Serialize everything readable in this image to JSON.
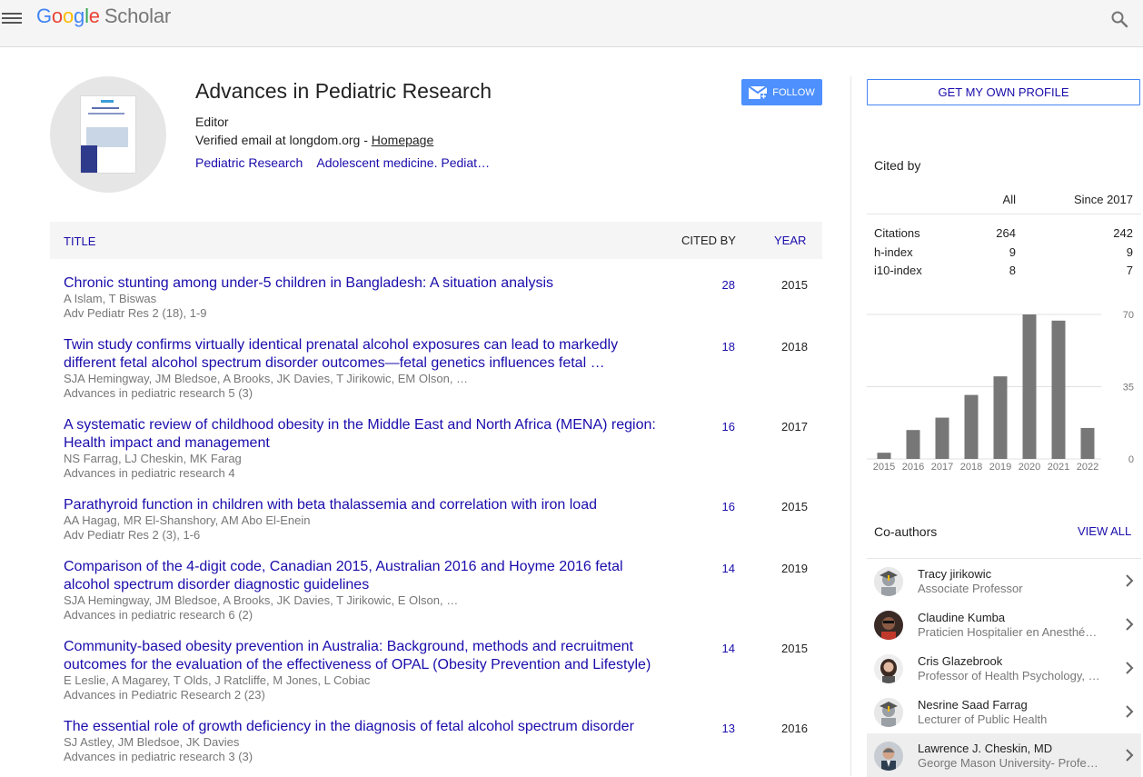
{
  "header": {
    "logo_google": [
      "G",
      "o",
      "o",
      "g",
      "l",
      "e"
    ],
    "logo_scholar": "Scholar",
    "menu_icon": "hamburger-menu-icon",
    "search_icon": "search-icon"
  },
  "profile": {
    "name": "Advances in Pediatric Research",
    "affiliation": "Editor",
    "email_text": "Verified email at longdom.org - ",
    "homepage_link": "Homepage",
    "interests": [
      "Pediatric Research",
      "Adolescent medicine. Pediat…"
    ],
    "follow_label": "FOLLOW",
    "follow_icon": "envelope-icon"
  },
  "table": {
    "headers": {
      "title": "TITLE",
      "cited_by": "CITED BY",
      "year": "YEAR"
    },
    "articles": [
      {
        "title": "Chronic stunting among under-5 children in Bangladesh: A situation analysis",
        "authors": "A Islam, T Biswas",
        "venue": "Adv Pediatr Res 2 (18), 1-9",
        "cited_by": "28",
        "year": "2015"
      },
      {
        "title": "Twin study confirms virtually identical prenatal alcohol exposures can lead to markedly different fetal alcohol spectrum disorder outcomes—fetal genetics influences fetal …",
        "authors": "SJA Hemingway, JM Bledsoe, A Brooks, JK Davies, T Jirikowic, EM Olson, …",
        "venue": "Advances in pediatric research 5 (3)",
        "cited_by": "18",
        "year": "2018"
      },
      {
        "title": "A systematic review of childhood obesity in the Middle East and North Africa (MENA) region: Health impact and management",
        "authors": "NS Farrag, LJ Cheskin, MK Farag",
        "venue": "Advances in pediatric research 4",
        "cited_by": "16",
        "year": "2017"
      },
      {
        "title": "Parathyroid function in children with beta thalassemia and correlation with iron load",
        "authors": "AA Hagag, MR El-Shanshory, AM Abo El-Enein",
        "venue": "Adv Pediatr Res 2 (3), 1-6",
        "cited_by": "16",
        "year": "2015"
      },
      {
        "title": "Comparison of the 4-digit code, Canadian 2015, Australian 2016 and Hoyme 2016 fetal alcohol spectrum disorder diagnostic guidelines",
        "authors": "SJA Hemingway, JM Bledsoe, A Brooks, JK Davies, T Jirikowic, E Olson, …",
        "venue": "Advances in pediatric research 6 (2)",
        "cited_by": "14",
        "year": "2019"
      },
      {
        "title": "Community-based obesity prevention in Australia: Background, methods and recruitment outcomes for the evaluation of the effectiveness of OPAL (Obesity Prevention and Lifestyle)",
        "authors": "E Leslie, A Magarey, T Olds, J Ratcliffe, M Jones, L Cobiac",
        "venue": "Advances in Pediatric Research 2 (23)",
        "cited_by": "14",
        "year": "2015"
      },
      {
        "title": "The essential role of growth deficiency in the diagnosis of fetal alcohol spectrum disorder",
        "authors": "SJ Astley, JM Bledsoe, JK Davies",
        "venue": "Advances in pediatric research 3 (3)",
        "cited_by": "13",
        "year": "2016"
      }
    ]
  },
  "sidebar": {
    "own_profile_label": "GET MY OWN PROFILE",
    "cited_by_title": "Cited by",
    "cited_by_cols": {
      "all": "All",
      "since": "Since 2017"
    },
    "cited_by_rows": [
      {
        "label": "Citations",
        "all": "264",
        "since": "242"
      },
      {
        "label": "h-index",
        "all": "9",
        "since": "9"
      },
      {
        "label": "i10-index",
        "all": "8",
        "since": "7"
      }
    ],
    "coauthors_title": "Co-authors",
    "view_all": "VIEW ALL",
    "coauthors": [
      {
        "name": "Tracy jirikowic",
        "affiliation": "Associate Professor",
        "photo": "default-avatar-icon"
      },
      {
        "name": "Claudine Kumba",
        "affiliation": "Praticien Hospitalier en Anesthé…",
        "photo": "person-photo"
      },
      {
        "name": "Cris Glazebrook",
        "affiliation": "Professor of Health Psychology, …",
        "photo": "person-photo"
      },
      {
        "name": "Nesrine Saad Farrag",
        "affiliation": "Lecturer of Public Health",
        "photo": "default-avatar-icon"
      },
      {
        "name": "Lawrence J. Cheskin, MD",
        "affiliation": "George Mason University- Profes…",
        "photo": "person-photo"
      }
    ]
  },
  "chart_data": {
    "type": "bar",
    "categories": [
      "2015",
      "2016",
      "2017",
      "2018",
      "2019",
      "2020",
      "2021",
      "2022"
    ],
    "values": [
      3,
      14,
      20,
      31,
      40,
      70,
      67,
      15
    ],
    "ylim": [
      0,
      70
    ],
    "yticks": [
      "70",
      "35",
      "0"
    ],
    "grid": true,
    "bar_color": "#777777"
  },
  "colors": {
    "link": "#1a0dab",
    "accent": "#4d90fe",
    "muted": "#777777"
  }
}
